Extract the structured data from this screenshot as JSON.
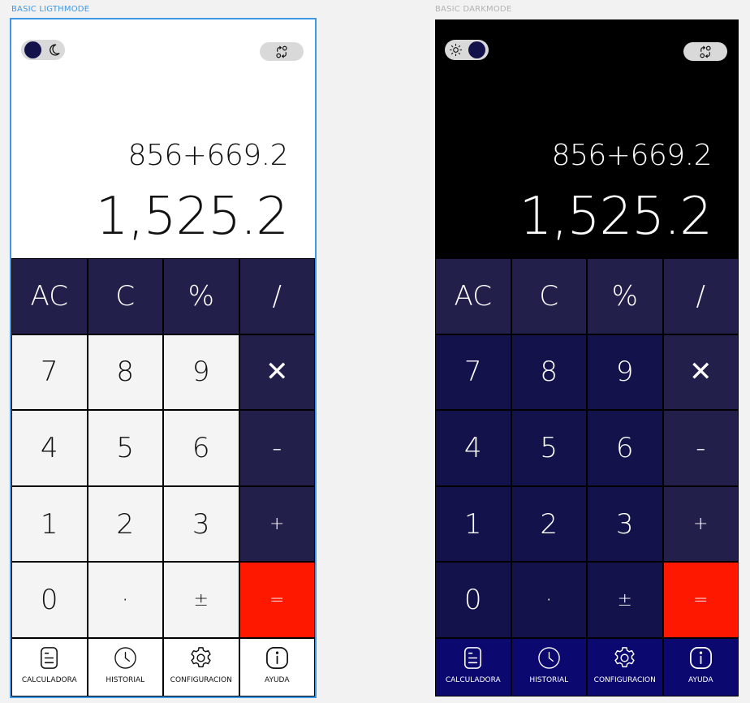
{
  "frames": {
    "light": {
      "label": "BASIC LIGTHMODE",
      "label_color": "#3d99e6"
    },
    "dark": {
      "label": "BASIC DARKMODE",
      "label_color": "#b3b3b3"
    }
  },
  "display": {
    "expression": "856+669.2",
    "result": "1,525.2"
  },
  "keys": {
    "ac": "AC",
    "c": "C",
    "percent": "%",
    "divide": "/",
    "seven": "7",
    "eight": "8",
    "nine": "9",
    "multiply": "✕",
    "four": "4",
    "five": "5",
    "six": "6",
    "minus": "-",
    "one": "1",
    "two": "2",
    "three": "3",
    "plus": "+",
    "zero": "0",
    "dot": "·",
    "plusminus": "±",
    "equals": "="
  },
  "tabs": {
    "calculator": "CALCULADORA",
    "history": "HISTORIAL",
    "settings": "CONFIGURACION",
    "help": "AYUDA"
  },
  "colors": {
    "operator": "#22204a",
    "equals": "#ff1800",
    "dark_number": "#13124a",
    "dark_tab": "#0b0870"
  }
}
